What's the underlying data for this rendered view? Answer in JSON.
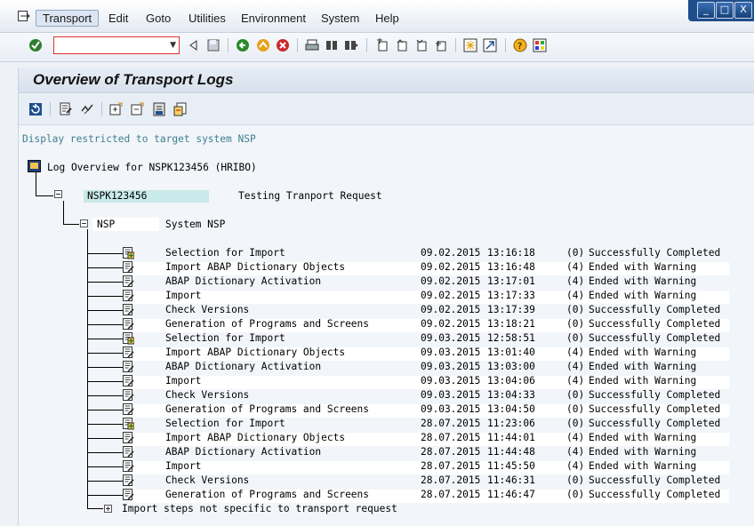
{
  "menu": {
    "items": [
      "Transport",
      "Edit",
      "Goto",
      "Utilities",
      "Environment",
      "System",
      "Help"
    ]
  },
  "window_controls": {
    "minimize": "_",
    "maximize": "□",
    "close": "X"
  },
  "command_field": {
    "value": "",
    "placeholder": ""
  },
  "title": "Overview of Transport Logs",
  "restriction_note": "Display restricted to target system NSP",
  "tree": {
    "root_label": "Log Overview for NSPK123456 (HRIBO)",
    "request_id": "NSPK123456",
    "request_desc": "Testing Tranport Request",
    "system_id": "NSP",
    "system_desc": "System NSP",
    "footer_label": "Import steps not specific to transport request",
    "steps": [
      {
        "step": "Selection for Import",
        "date": "09.02.2015",
        "time": "13:16:18",
        "rc": "(0)",
        "status": "Successfully Completed",
        "icon": "select-icon"
      },
      {
        "step": "Import ABAP Dictionary Objects",
        "date": "09.02.2015",
        "time": "13:16:48",
        "rc": "(4)",
        "status": "Ended with Warning",
        "icon": "log-icon"
      },
      {
        "step": "ABAP Dictionary Activation",
        "date": "09.02.2015",
        "time": "13:17:01",
        "rc": "(4)",
        "status": "Ended with Warning",
        "icon": "log-icon"
      },
      {
        "step": "Import",
        "date": "09.02.2015",
        "time": "13:17:33",
        "rc": "(4)",
        "status": "Ended with Warning",
        "icon": "log-icon"
      },
      {
        "step": "Check Versions",
        "date": "09.02.2015",
        "time": "13:17:39",
        "rc": "(0)",
        "status": "Successfully Completed",
        "icon": "log-icon"
      },
      {
        "step": "Generation of Programs and Screens",
        "date": "09.02.2015",
        "time": "13:18:21",
        "rc": "(0)",
        "status": "Successfully Completed",
        "icon": "log-icon"
      },
      {
        "step": "Selection for Import",
        "date": "09.03.2015",
        "time": "12:58:51",
        "rc": "(0)",
        "status": "Successfully Completed",
        "icon": "select-icon"
      },
      {
        "step": "Import ABAP Dictionary Objects",
        "date": "09.03.2015",
        "time": "13:01:40",
        "rc": "(4)",
        "status": "Ended with Warning",
        "icon": "log-icon"
      },
      {
        "step": "ABAP Dictionary Activation",
        "date": "09.03.2015",
        "time": "13:03:00",
        "rc": "(4)",
        "status": "Ended with Warning",
        "icon": "log-icon"
      },
      {
        "step": "Import",
        "date": "09.03.2015",
        "time": "13:04:06",
        "rc": "(4)",
        "status": "Ended with Warning",
        "icon": "log-icon"
      },
      {
        "step": "Check Versions",
        "date": "09.03.2015",
        "time": "13:04:33",
        "rc": "(0)",
        "status": "Successfully Completed",
        "icon": "log-icon"
      },
      {
        "step": "Generation of Programs and Screens",
        "date": "09.03.2015",
        "time": "13:04:50",
        "rc": "(0)",
        "status": "Successfully Completed",
        "icon": "log-icon"
      },
      {
        "step": "Selection for Import",
        "date": "28.07.2015",
        "time": "11:23:06",
        "rc": "(0)",
        "status": "Successfully Completed",
        "icon": "select-icon"
      },
      {
        "step": "Import ABAP Dictionary Objects",
        "date": "28.07.2015",
        "time": "11:44:01",
        "rc": "(4)",
        "status": "Ended with Warning",
        "icon": "log-icon"
      },
      {
        "step": "ABAP Dictionary Activation",
        "date": "28.07.2015",
        "time": "11:44:48",
        "rc": "(4)",
        "status": "Ended with Warning",
        "icon": "log-icon"
      },
      {
        "step": "Import",
        "date": "28.07.2015",
        "time": "11:45:50",
        "rc": "(4)",
        "status": "Ended with Warning",
        "icon": "log-icon"
      },
      {
        "step": "Check Versions",
        "date": "28.07.2015",
        "time": "11:46:31",
        "rc": "(0)",
        "status": "Successfully Completed",
        "icon": "log-icon"
      },
      {
        "step": "Generation of Programs and Screens",
        "date": "28.07.2015",
        "time": "11:46:47",
        "rc": "(0)",
        "status": "Successfully Completed",
        "icon": "log-icon"
      }
    ]
  },
  "colors": {
    "accent": "#1f4e8c",
    "restriction_text": "#3e7f92",
    "highlight": "#c9eaea",
    "error_border": "#dd3333"
  }
}
